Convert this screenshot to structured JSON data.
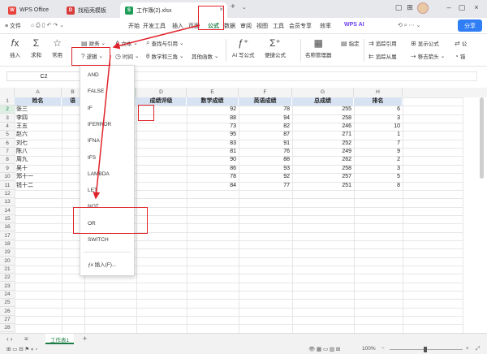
{
  "tabs": [
    {
      "label": "WPS Office",
      "icon_color": "#e8413a"
    },
    {
      "label": "找稻壳模板",
      "icon_color": "#d93b3b"
    },
    {
      "label": "工作簿(2).xlsx",
      "icon_color": "#1e9e58"
    }
  ],
  "new_tab_symbol": "+",
  "menu": {
    "file": "≡ 文件",
    "items": [
      "开始",
      "开发工具",
      "插入",
      "页面",
      "公式",
      "数据",
      "审阅",
      "视图",
      "工具",
      "会员专享",
      "效率"
    ],
    "active": "公式",
    "wps_ai": "WPS AI",
    "share": "分享"
  },
  "ribbon": {
    "insert_fn": "插入",
    "sum": "求和",
    "common": "常用",
    "finance": "财务",
    "logic": "逻辑",
    "text": "文本",
    "time": "时间",
    "lookup": "查找与引用",
    "math": "数学和三角",
    "other": "其他函数",
    "ai_formula": "AI 写公式",
    "quick_formula": "便捷公式",
    "name_manager": "名称管理器",
    "specify": "指定",
    "trace_precedents": "追踪引用",
    "trace_dependents": "追踪从属",
    "show_formula": "显示公式",
    "remove_arrows": "移去箭头",
    "formula_abbrev": "公",
    "error_abbrev": "错"
  },
  "formula_bar": {
    "name_box": "C2",
    "fx": "fx"
  },
  "columns": [
    "A",
    "B",
    "C",
    "D",
    "E",
    "F",
    "G",
    "H"
  ],
  "selected_column": "C",
  "selected_row": 2,
  "table": {
    "headers": [
      "姓名",
      "语",
      "",
      "成绩评级",
      "数学成绩",
      "英语成绩",
      "总成绩",
      "排名"
    ],
    "rows": [
      [
        "张三",
        "",
        "",
        "",
        "92",
        "78",
        "255",
        "6"
      ],
      [
        "李四",
        "",
        "",
        "",
        "88",
        "94",
        "258",
        "3"
      ],
      [
        "王五",
        "",
        "",
        "",
        "73",
        "82",
        "246",
        "10"
      ],
      [
        "赵六",
        "",
        "",
        "",
        "95",
        "87",
        "271",
        "1"
      ],
      [
        "刘七",
        "",
        "",
        "",
        "83",
        "91",
        "252",
        "7"
      ],
      [
        "陈八",
        "",
        "",
        "",
        "81",
        "76",
        "249",
        "9"
      ],
      [
        "周九",
        "",
        "",
        "",
        "90",
        "88",
        "262",
        "2"
      ],
      [
        "吴十",
        "",
        "",
        "",
        "86",
        "93",
        "258",
        "3"
      ],
      [
        "郑十一",
        "",
        "",
        "",
        "78",
        "92",
        "257",
        "5"
      ],
      [
        "钱十二",
        "",
        "",
        "",
        "84",
        "77",
        "251",
        "8"
      ]
    ]
  },
  "c1_partial": "况",
  "row_numbers": [
    "1",
    "2",
    "3",
    "4",
    "5",
    "6",
    "7",
    "8",
    "9",
    "10",
    "11",
    "12",
    "13",
    "14",
    "15",
    "16",
    "17",
    "18",
    "19",
    "20",
    "21",
    "22",
    "23",
    "24",
    "25",
    "26",
    "27",
    "28"
  ],
  "logic_menu": [
    "AND",
    "FALSE",
    "IF",
    "IFERROR",
    "IFNA",
    "IFS",
    "LAMBDA",
    "LET",
    "NOT",
    "OR",
    "SWITCH"
  ],
  "insert_function": "插入(F)...",
  "sheet": {
    "name": "工作表1",
    "add": "+"
  },
  "status": {
    "zoom": "100%"
  },
  "annotation_color": "#e0242c"
}
